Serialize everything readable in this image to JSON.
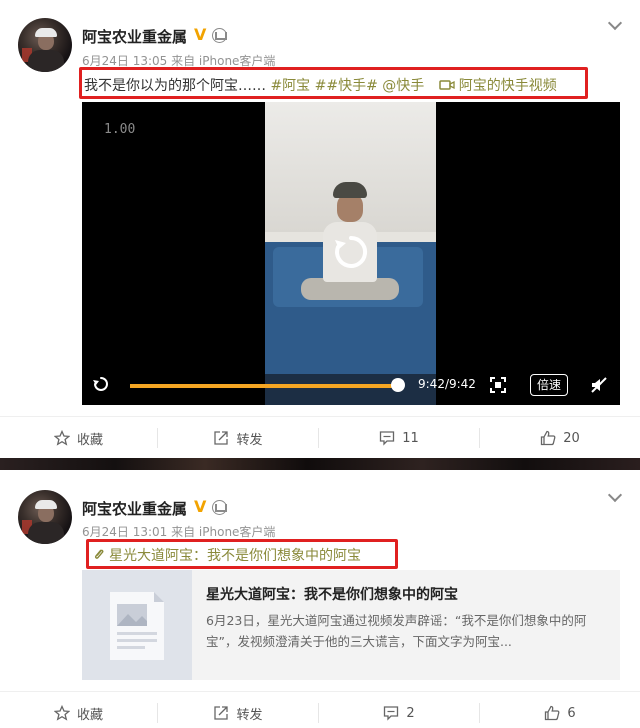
{
  "posts": [
    {
      "username": "阿宝农业重金属",
      "verified_badge": "V",
      "meta": "6月24日 13:05 来自 iPhone客户端",
      "text": {
        "main": "我不是你以为的那个阿宝……",
        "tag1": "#阿宝",
        "tag2": "##快手#",
        "mention": "@快手",
        "video_link": "阿宝的快手视频"
      },
      "video": {
        "rate": "1.00",
        "time": "9:42/9:42",
        "progress": 1.0,
        "speed_label": "倍速"
      },
      "actions": {
        "favorite": "收藏",
        "repost": "转发",
        "comments": "11",
        "likes": "20"
      }
    },
    {
      "username": "阿宝农业重金属",
      "verified_badge": "V",
      "meta": "6月24日 13:01 来自 iPhone客户端",
      "link_text": "星光大道阿宝：我不是你们想象中的阿宝",
      "card": {
        "title": "星光大道阿宝：我不是你们想象中的阿宝",
        "desc": "6月23日，星光大道阿宝通过视频发声辟谣：“我不是你们想象中的阿宝”，发视频澄清关于他的三大谎言，下面文字为阿宝..."
      },
      "actions": {
        "favorite": "收藏",
        "repost": "转发",
        "comments": "2",
        "likes": "6"
      }
    }
  ],
  "colors": {
    "accent": "#f5a623",
    "tag": "#8a8a3a",
    "highlight": "#e02020",
    "verified": "#f2a300"
  }
}
